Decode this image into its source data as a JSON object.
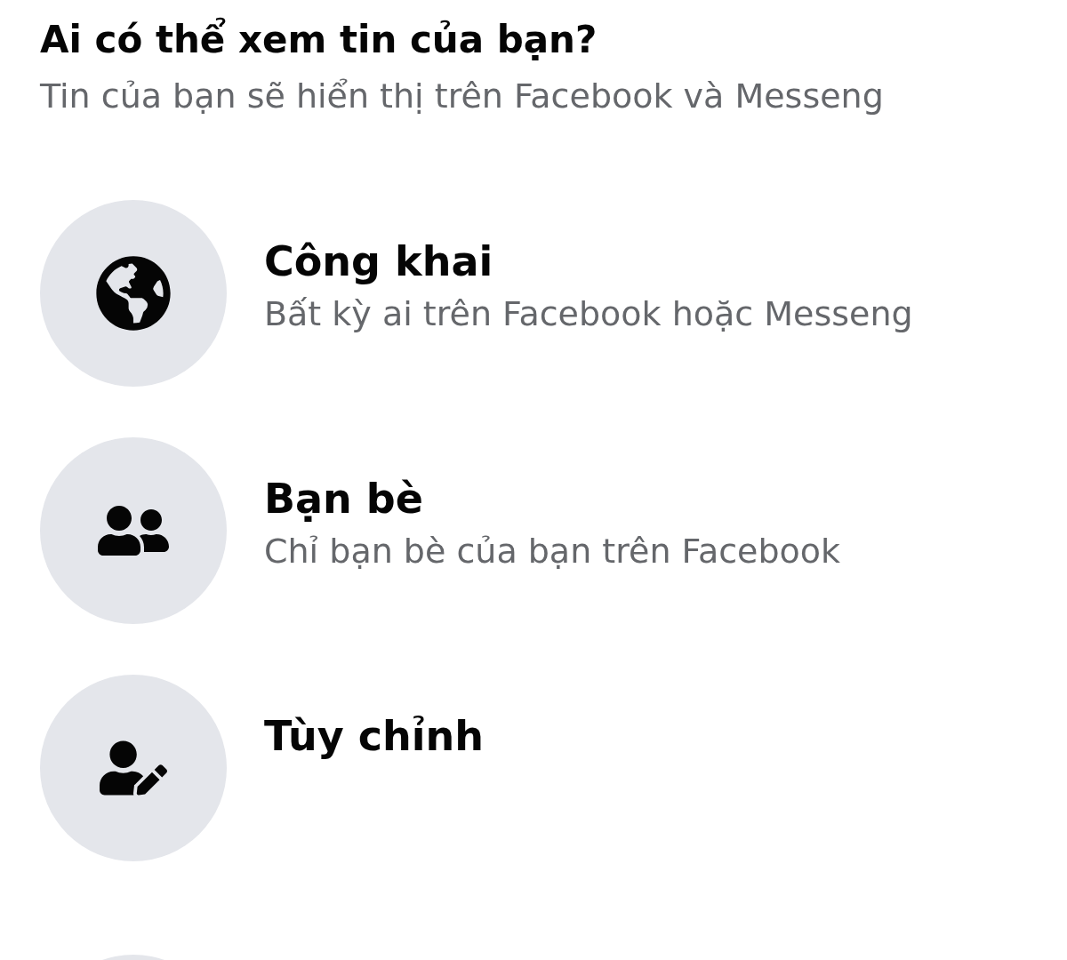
{
  "header": {
    "title": "Ai có thể xem tin của bạn?",
    "subtitle": "Tin của bạn sẽ hiển thị trên Facebook và Messeng"
  },
  "options": [
    {
      "kind": "public",
      "title": "Công khai",
      "description": "Bất kỳ ai trên Facebook hoặc Messeng"
    },
    {
      "kind": "friends",
      "title": "Bạn bè",
      "description": "Chỉ bạn bè của bạn trên Facebook"
    },
    {
      "kind": "custom",
      "title": "Tùy chỉnh"
    }
  ]
}
